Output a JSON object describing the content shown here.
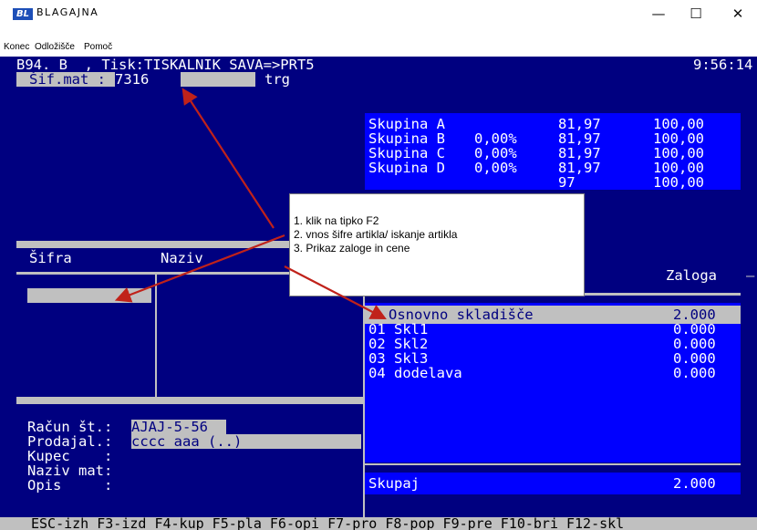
{
  "window": {
    "icon_text": "BL",
    "title": "BLAGAJNA",
    "minimize": "—",
    "maximize": "☐",
    "close": "✕"
  },
  "menu": [
    "Konec",
    "Odložišče",
    "Pomoč"
  ],
  "header": {
    "status_line": "B94._B  , Tisk:TISKALNIK SAVA=>PRT5",
    "time": "9:56:14"
  },
  "article": {
    "label": "Šif.mat :",
    "value": "7316",
    "unit": "trg"
  },
  "groups": [
    {
      "name": "Skupina A",
      "pct": "",
      "val1": "81,97",
      "val2": "100,00"
    },
    {
      "name": "Skupina B",
      "pct": "0,00%",
      "val1": "81,97",
      "val2": "100,00"
    },
    {
      "name": "Skupina C",
      "pct": "0,00%",
      "val1": "81,97",
      "val2": "100,00"
    },
    {
      "name": "Skupina D",
      "pct": "0,00%",
      "val1": "81,97",
      "val2": "100,00"
    },
    {
      "name": "",
      "pct": "",
      "val1": "97",
      "val2": "100,00"
    }
  ],
  "table": {
    "col_code": "Šifra",
    "col_name": "Naziv"
  },
  "stock": {
    "header": "Zaloga",
    "rows": [
      {
        "code": "",
        "name": "Osnovno skladišče",
        "qty": "2.000"
      },
      {
        "code": "01",
        "name": "Skl1",
        "qty": "0.000"
      },
      {
        "code": "02",
        "name": "Skl2",
        "qty": "0.000"
      },
      {
        "code": "03",
        "name": "Skl3",
        "qty": "0.000"
      },
      {
        "code": "04",
        "name": "dodelava",
        "qty": "0.000"
      }
    ],
    "total_label": "Skupaj",
    "total_qty": "2.000"
  },
  "invoice": {
    "racun_label": "Račun št.:",
    "racun_value": "AJAJ-5-56",
    "prodajal_label": "Prodajal.:",
    "prodajal_value": "cccc aaa (..)",
    "kupec_label": "Kupec    :",
    "naziv_label": "Naziv mat:",
    "opis_label": "Opis     :"
  },
  "function_keys": "ESC-izh F3-izd F4-kup F5-pla F6-opi F7-pro F8-pop F9-pre F10-bri F12-skl",
  "callout": {
    "line1": "1. klik na tipko F2",
    "line2": "2. vnos šifre artikla/ iskanje artikla",
    "line3": "3. Prikaz zaloge in cene"
  },
  "colors": {
    "console_bg": "#000080",
    "panel_bg": "#0000ff",
    "gray": "#c0c0c0",
    "arrow": "#c0221a"
  }
}
